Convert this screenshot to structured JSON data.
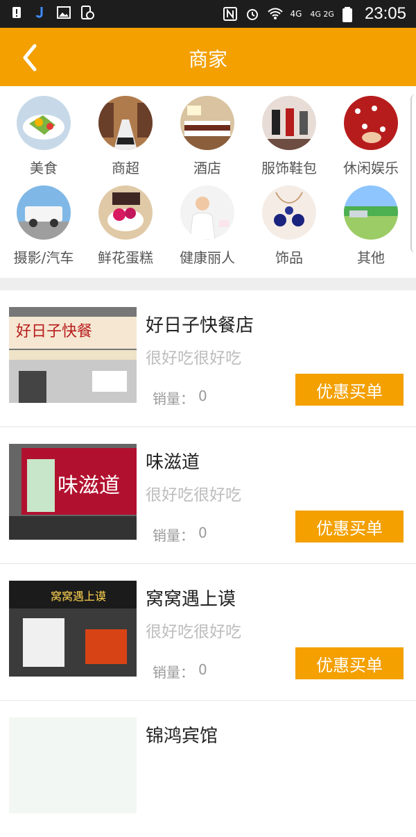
{
  "status": {
    "time": "23:05",
    "network": "4G",
    "network2": "4G 2G"
  },
  "header": {
    "title": "商家"
  },
  "categories": {
    "row1": [
      "美食",
      "商超",
      "酒店",
      "服饰鞋包",
      "休闲娱乐"
    ],
    "row2": [
      "摄影/汽车",
      "鲜花蛋糕",
      "健康丽人",
      "饰品",
      "其他"
    ]
  },
  "merchants": [
    {
      "name": "好日子快餐店",
      "desc": "很好吃很好吃",
      "sales_label": "销量：",
      "sales": "0",
      "button": "优惠买单",
      "sign": "好日子快餐"
    },
    {
      "name": "味滋道",
      "desc": "很好吃很好吃",
      "sales_label": "销量：",
      "sales": "0",
      "button": "优惠买单",
      "sign": "味滋道"
    },
    {
      "name": "窝窝遇上谟",
      "desc": "很好吃很好吃",
      "sales_label": "销量：",
      "sales": "0",
      "button": "优惠买单",
      "sign": "窝窝遇上谟"
    },
    {
      "name": "锦鸿宾馆",
      "desc": "",
      "sales_label": "",
      "sales": "",
      "button": "",
      "sign": ""
    }
  ],
  "colors": {
    "accent": "#F3A000",
    "statusbar": "#1d1d1d"
  }
}
